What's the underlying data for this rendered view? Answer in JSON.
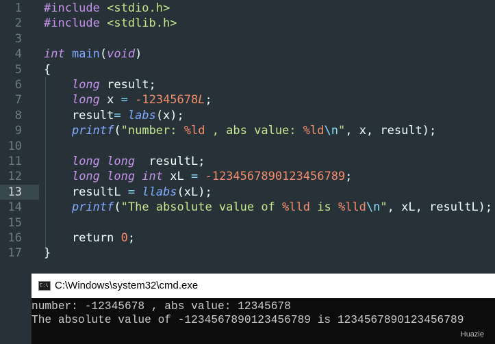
{
  "editor": {
    "line_numbers": [
      "1",
      "2",
      "3",
      "4",
      "5",
      "6",
      "7",
      "8",
      "9",
      "10",
      "11",
      "12",
      "13",
      "14",
      "15",
      "16",
      "17"
    ],
    "active_line": "13",
    "lines": [
      [
        {
          "t": "#include ",
          "c": "pre"
        },
        {
          "t": "<stdio.h>",
          "c": "hdr"
        }
      ],
      [
        {
          "t": "#include ",
          "c": "pre"
        },
        {
          "t": "<stdlib.h>",
          "c": "hdr"
        }
      ],
      [],
      [
        {
          "t": "int",
          "c": "type"
        },
        {
          "t": " ",
          "c": "plain"
        },
        {
          "t": "main",
          "c": "fn"
        },
        {
          "t": "(",
          "c": "plain"
        },
        {
          "t": "void",
          "c": "type"
        },
        {
          "t": ")",
          "c": "plain"
        }
      ],
      [
        {
          "t": "{",
          "c": "plain"
        }
      ],
      [
        {
          "t": "    ",
          "c": "plain"
        },
        {
          "t": "long",
          "c": "type"
        },
        {
          "t": " result;",
          "c": "plain"
        }
      ],
      [
        {
          "t": "    ",
          "c": "plain"
        },
        {
          "t": "long",
          "c": "type"
        },
        {
          "t": " x ",
          "c": "plain"
        },
        {
          "t": "=",
          "c": "op"
        },
        {
          "t": " ",
          "c": "plain"
        },
        {
          "t": "-12345678",
          "c": "num"
        },
        {
          "t": "L",
          "c": "suffix"
        },
        {
          "t": ";",
          "c": "plain"
        }
      ],
      [
        {
          "t": "    result",
          "c": "plain"
        },
        {
          "t": "=",
          "c": "op"
        },
        {
          "t": " ",
          "c": "plain"
        },
        {
          "t": "labs",
          "c": "fni"
        },
        {
          "t": "(x);",
          "c": "plain"
        }
      ],
      [
        {
          "t": "    ",
          "c": "plain"
        },
        {
          "t": "printf",
          "c": "fni"
        },
        {
          "t": "(",
          "c": "plain"
        },
        {
          "t": "\"number: ",
          "c": "str"
        },
        {
          "t": "%ld",
          "c": "fmt"
        },
        {
          "t": " , abs value: ",
          "c": "str"
        },
        {
          "t": "%ld",
          "c": "fmt"
        },
        {
          "t": "\\n",
          "c": "op"
        },
        {
          "t": "\"",
          "c": "str"
        },
        {
          "t": ", x, result);",
          "c": "plain"
        }
      ],
      [],
      [
        {
          "t": "    ",
          "c": "plain"
        },
        {
          "t": "long long",
          "c": "type"
        },
        {
          "t": "  resultL;",
          "c": "plain"
        }
      ],
      [
        {
          "t": "    ",
          "c": "plain"
        },
        {
          "t": "long long int",
          "c": "type"
        },
        {
          "t": " xL ",
          "c": "plain"
        },
        {
          "t": "=",
          "c": "op"
        },
        {
          "t": " ",
          "c": "plain"
        },
        {
          "t": "-1234567890123456789",
          "c": "num"
        },
        {
          "t": ";",
          "c": "plain"
        }
      ],
      [
        {
          "t": "    resultL ",
          "c": "plain"
        },
        {
          "t": "=",
          "c": "op"
        },
        {
          "t": " ",
          "c": "plain"
        },
        {
          "t": "llabs",
          "c": "fni"
        },
        {
          "t": "(xL);",
          "c": "plain"
        }
      ],
      [
        {
          "t": "    ",
          "c": "plain"
        },
        {
          "t": "printf",
          "c": "fni"
        },
        {
          "t": "(",
          "c": "plain"
        },
        {
          "t": "\"The absolute value of ",
          "c": "str"
        },
        {
          "t": "%lld",
          "c": "fmt"
        },
        {
          "t": " is ",
          "c": "str"
        },
        {
          "t": "%lld",
          "c": "fmt"
        },
        {
          "t": "\\n",
          "c": "op"
        },
        {
          "t": "\"",
          "c": "str"
        },
        {
          "t": ", xL, resultL);",
          "c": "plain"
        }
      ],
      [],
      [
        {
          "t": "    return ",
          "c": "plain"
        },
        {
          "t": "0",
          "c": "num"
        },
        {
          "t": ";",
          "c": "plain"
        }
      ],
      [
        {
          "t": "}",
          "c": "plain"
        }
      ]
    ]
  },
  "console": {
    "icon": "cmd-icon",
    "icon_text": "C:\\",
    "title": "C:\\Windows\\system32\\cmd.exe",
    "output": [
      "number: -12345678 , abs value: 12345678",
      "The absolute value of -1234567890123456789 is 1234567890123456789"
    ]
  },
  "watermark": "Huazie",
  "colors": {
    "editor_bg": "#263238",
    "keyword": "#c792ea",
    "function": "#82aaff",
    "string": "#c3e88d",
    "number": "#f78c6c",
    "operator": "#89ddff",
    "console_bg": "#0c0c0c",
    "console_text": "#cccccc"
  }
}
